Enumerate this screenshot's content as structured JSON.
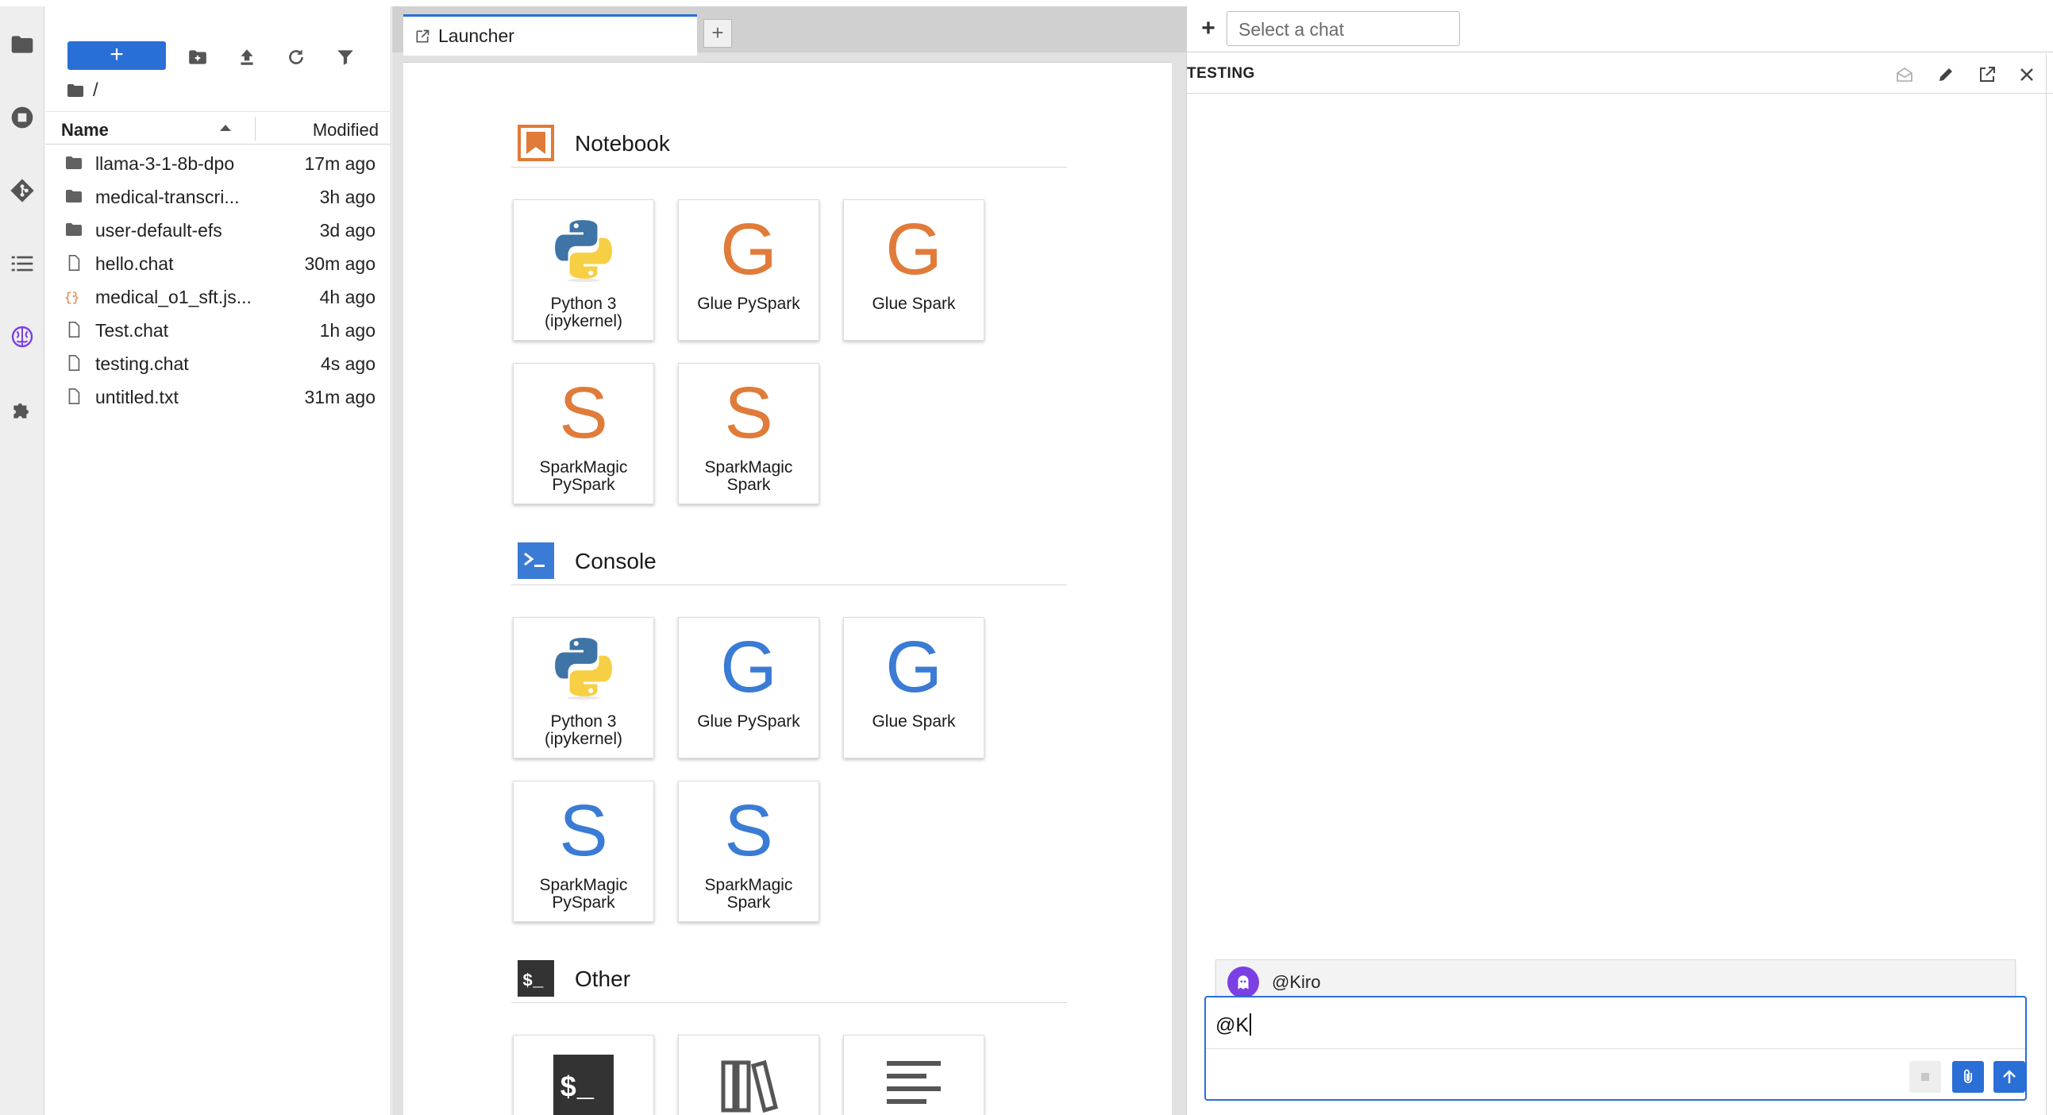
{
  "activity_bar": {
    "icons": [
      "folder-icon",
      "running-stop-icon",
      "git-icon",
      "table-of-contents-icon",
      "ai-brain-icon",
      "extension-puzzle-icon"
    ]
  },
  "file_browser": {
    "new_label": "+",
    "breadcrumb": "/",
    "columns": {
      "name": "Name",
      "modified": "Modified"
    },
    "files": [
      {
        "name": "llama-3-1-8b-dpo",
        "modified": "17m ago",
        "type": "folder"
      },
      {
        "name": "medical-transcri...",
        "modified": "3h ago",
        "type": "folder"
      },
      {
        "name": "user-default-efs",
        "modified": "3d ago",
        "type": "folder"
      },
      {
        "name": "hello.chat",
        "modified": "30m ago",
        "type": "file"
      },
      {
        "name": "medical_o1_sft.js...",
        "modified": "4h ago",
        "type": "json"
      },
      {
        "name": "Test.chat",
        "modified": "1h ago",
        "type": "file"
      },
      {
        "name": "testing.chat",
        "modified": "4s ago",
        "type": "file"
      },
      {
        "name": "untitled.txt",
        "modified": "31m ago",
        "type": "file"
      }
    ]
  },
  "launcher": {
    "tab_label": "Launcher",
    "tab_add": "+",
    "sections": {
      "notebook": {
        "title": "Notebook",
        "items": [
          {
            "label": "Python 3 (ipykernel)",
            "icon": "python"
          },
          {
            "label": "Glue PySpark",
            "icon": "G"
          },
          {
            "label": "Glue Spark",
            "icon": "G"
          },
          {
            "label": "SparkMagic PySpark",
            "icon": "S"
          },
          {
            "label": "SparkMagic Spark",
            "icon": "S"
          }
        ]
      },
      "console": {
        "title": "Console",
        "items": [
          {
            "label": "Python 3 (ipykernel)",
            "icon": "python"
          },
          {
            "label": "Glue PySpark",
            "icon": "G"
          },
          {
            "label": "Glue Spark",
            "icon": "G"
          },
          {
            "label": "SparkMagic PySpark",
            "icon": "S"
          },
          {
            "label": "SparkMagic Spark",
            "icon": "S"
          }
        ]
      },
      "other": {
        "title": "Other",
        "items": [
          {
            "icon": "terminal"
          },
          {
            "icon": "books"
          },
          {
            "icon": "text-lines"
          }
        ]
      }
    },
    "colors": {
      "notebook_accent": "#e07b39",
      "console_accent": "#3a7bd5",
      "other_accent": "#333333"
    }
  },
  "chat": {
    "add_label": "+",
    "select_placeholder": "Select a chat",
    "title": "TESTING",
    "suggestion": "@Kiro",
    "input_value": "@K",
    "colors": {
      "accent": "#2a6fd6",
      "avatar": "#7b3fe4"
    }
  }
}
